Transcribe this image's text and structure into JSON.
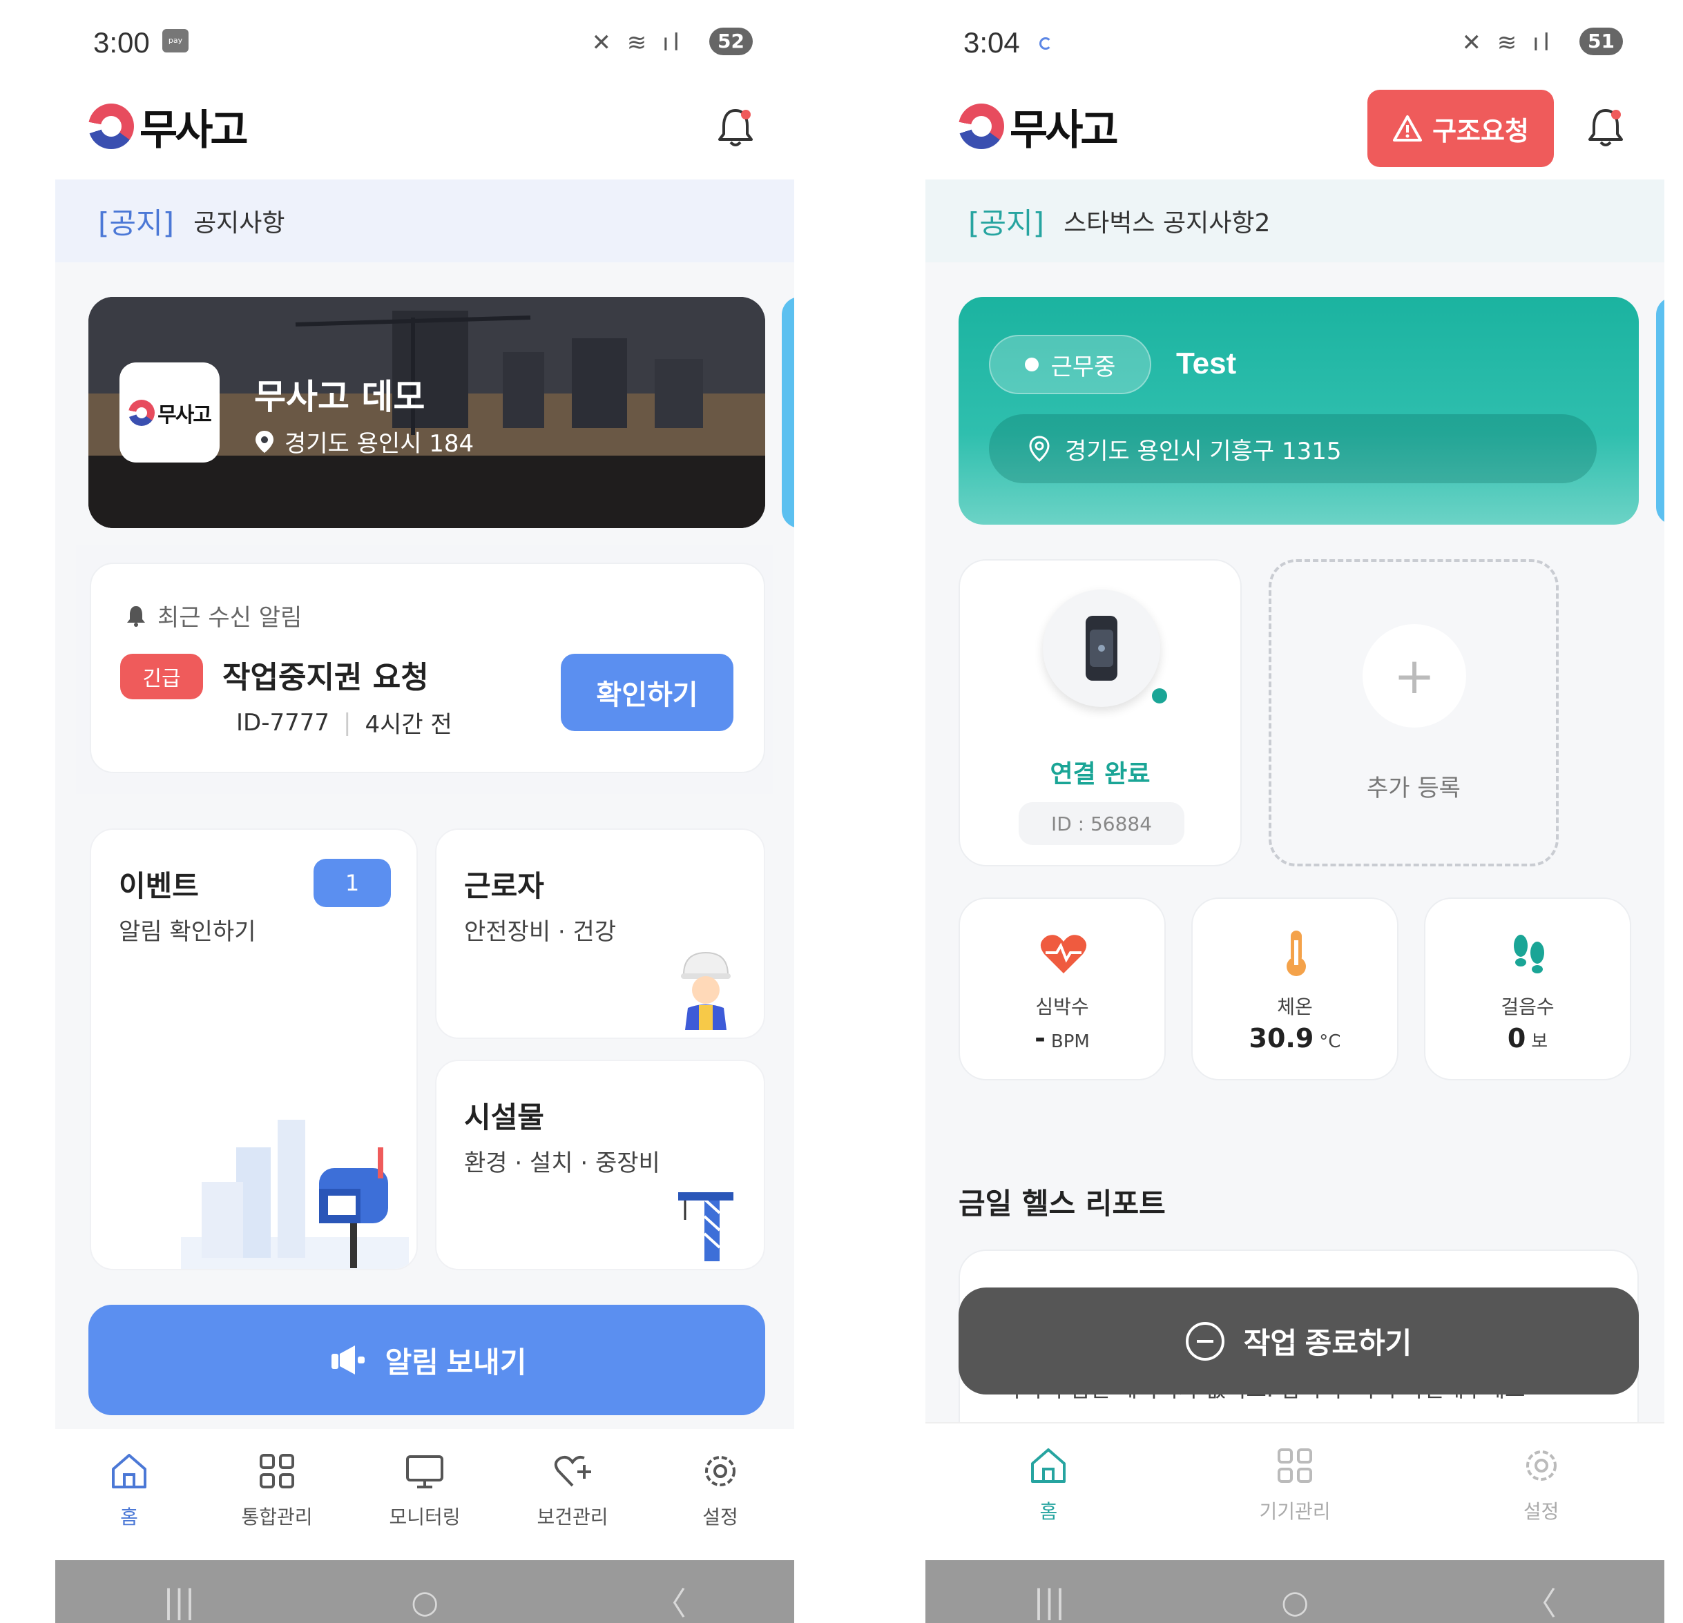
{
  "left": {
    "status": {
      "time": "3:00",
      "pay": "pay",
      "battery": "52"
    },
    "logo": "무사고",
    "notice": {
      "tag": "[공지]",
      "text": "공지사항"
    },
    "site": {
      "name": "무사고 데모",
      "address": "경기도 용인시 184",
      "logo": "무사고"
    },
    "recent_alert": {
      "header": "최근 수신 알림",
      "badge": "긴급",
      "title": "작업중지권 요청",
      "id": "ID-7777",
      "time": "4시간 전",
      "button": "확인하기"
    },
    "tiles": {
      "event": {
        "title": "이벤트",
        "sub": "알림 확인하기",
        "badge": "1"
      },
      "worker": {
        "title": "근로자",
        "sub": "안전장비 · 건강"
      },
      "facility": {
        "title": "시설물",
        "sub": "환경 · 설치 · 중장비"
      }
    },
    "send_button": "알림 보내기",
    "nav": [
      "홈",
      "통합관리",
      "모니터링",
      "보건관리",
      "설정"
    ],
    "icons": [
      "home-icon",
      "grid-icon",
      "monitor-icon",
      "heart-plus-icon",
      "gear-icon"
    ]
  },
  "right": {
    "status": {
      "time": "3:04",
      "battery": "51"
    },
    "logo": "무사고",
    "sos_button": "구조요청",
    "notice": {
      "tag": "[공지]",
      "text": "스타벅스 공지사항2"
    },
    "work": {
      "status": "근무중",
      "name": "Test",
      "address": "경기도 용인시 기흥구 1315"
    },
    "device": {
      "state": "연결 완료",
      "id": "ID : 56884"
    },
    "add_device": {
      "label": "추가 등록",
      "plus": "+"
    },
    "vitals": [
      {
        "label": "심박수",
        "value": "-",
        "unit": "BPM"
      },
      {
        "label": "체온",
        "value": "30.9",
        "unit": "°C"
      },
      {
        "label": "걸음수",
        "value": "0",
        "unit": "보"
      }
    ],
    "report": {
      "title": "금일 헬스 리포트",
      "partial_text": "아직 수집된 데이터가 없어요. 잠시 후 다시 확인해주세요"
    },
    "end_button": "작업 종료하기",
    "nav": [
      "홈",
      "기기관리",
      "설정"
    ]
  },
  "colors": {
    "blue_accent": "#5b8ff0",
    "teal_accent": "#1aa596",
    "urgent_red": "#ef5b5b",
    "end_button": "#565656"
  }
}
